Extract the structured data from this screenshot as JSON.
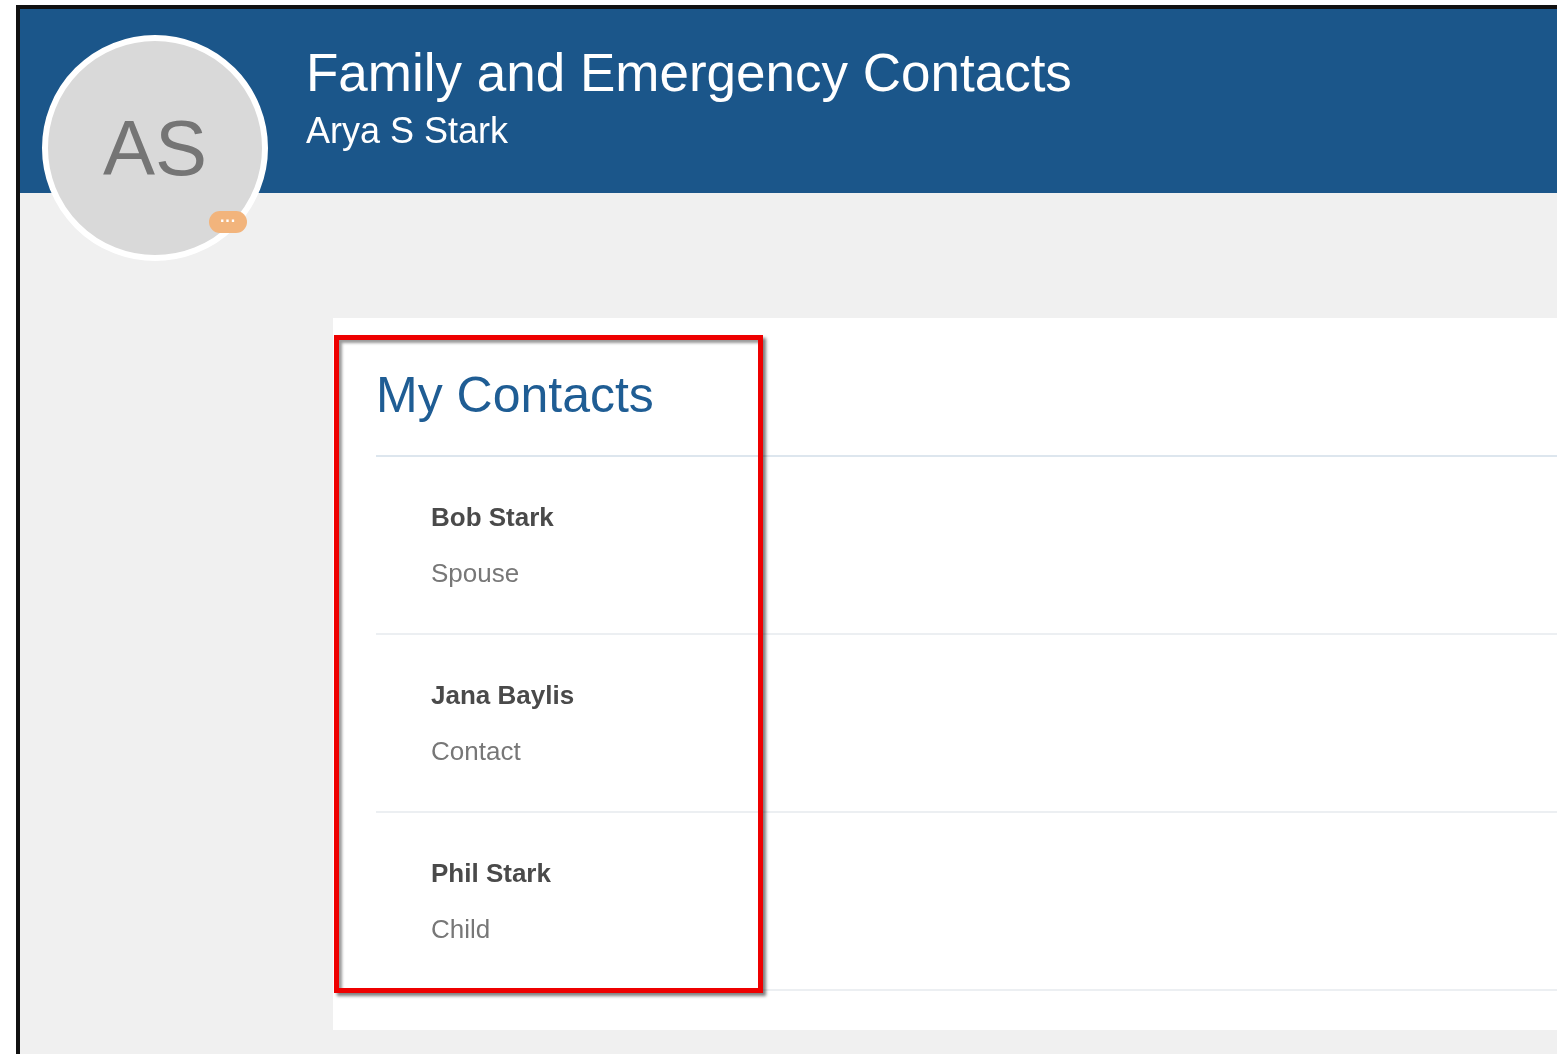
{
  "header": {
    "initials": "AS",
    "title": "Family and Emergency Contacts",
    "subtitle": "Arya S Stark",
    "badge": "···"
  },
  "my_contacts": {
    "title": "My Contacts",
    "highlighted": true,
    "contacts": [
      {
        "name": "Bob Stark",
        "relation": "Spouse"
      },
      {
        "name": "Jana Baylis",
        "relation": "Contact"
      },
      {
        "name": "Phil Stark",
        "relation": "Child"
      }
    ]
  }
}
